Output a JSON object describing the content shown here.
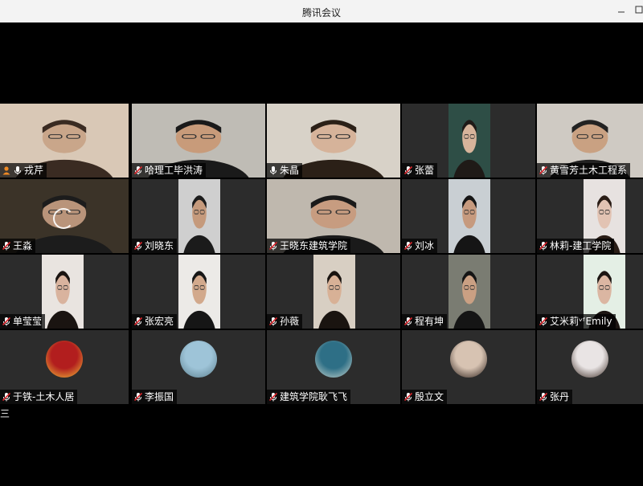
{
  "window": {
    "title": "腾讯会议",
    "minimize_glyph": "☐",
    "close_glyph": "☐"
  },
  "colors": {
    "mic_muted": "#d9262c",
    "mic_on": "#ffffff",
    "label_bg": "#000000",
    "host_badge": "#f08a24"
  },
  "participants": [
    {
      "name": "戎芹",
      "mic": "mic-on-icon",
      "host_badge": "host-user-icon"
    },
    {
      "name": "哈理工毕洪涛",
      "mic": "mic-muted-icon"
    },
    {
      "name": "朱晶",
      "mic": "mic-on-icon"
    },
    {
      "name": "张蕾",
      "mic": "mic-muted-icon"
    },
    {
      "name": "黄雪芳土木工程系",
      "mic": "mic-muted-icon"
    },
    {
      "name": "王淼",
      "mic": "mic-muted-icon"
    },
    {
      "name": "刘晓东",
      "mic": "mic-muted-icon"
    },
    {
      "name": "王晓东建筑学院",
      "mic": "mic-muted-icon"
    },
    {
      "name": "刘冰",
      "mic": "mic-muted-icon"
    },
    {
      "name": "林莉-建工学院",
      "mic": "mic-muted-icon"
    },
    {
      "name": "单莹莹",
      "mic": "mic-muted-icon"
    },
    {
      "name": "张宏亮",
      "mic": "mic-muted-icon"
    },
    {
      "name": "孙薇",
      "mic": "mic-muted-icon"
    },
    {
      "name": "程有坤",
      "mic": "mic-muted-icon"
    },
    {
      "name": "艾米莉ᵛᶠEmily",
      "mic": "mic-muted-icon"
    },
    {
      "name": "于铁-土木人居",
      "mic": "mic-muted-icon"
    },
    {
      "name": "李振国",
      "mic": "mic-muted-icon"
    },
    {
      "name": "建筑学院耿飞飞",
      "mic": "mic-muted-icon"
    },
    {
      "name": "殷立文",
      "mic": "mic-muted-icon"
    },
    {
      "name": "张丹",
      "mic": "mic-muted-icon"
    }
  ],
  "side_menu_glyph": "三"
}
